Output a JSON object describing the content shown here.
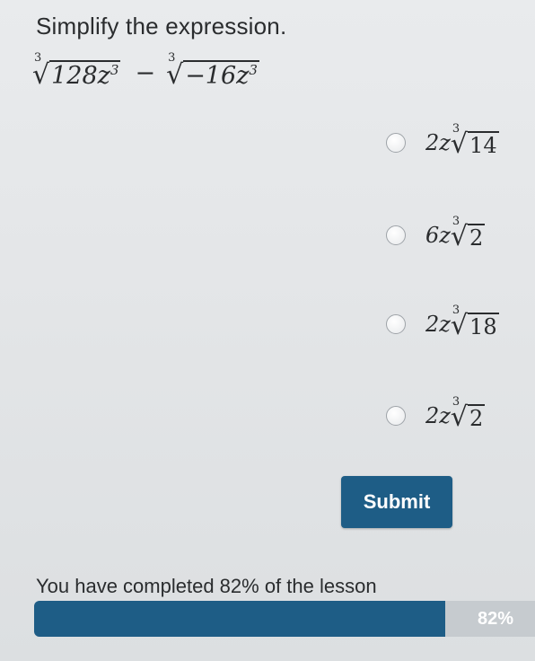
{
  "question": {
    "prompt": "Simplify the expression.",
    "expression": {
      "term1": {
        "index": "3",
        "radicand": "128z",
        "exponent": "3"
      },
      "operator": "−",
      "term2": {
        "index": "3",
        "radicand": "−16z",
        "exponent": "3"
      }
    }
  },
  "options": [
    {
      "coef": "2z",
      "index": "3",
      "radicand": "14"
    },
    {
      "coef": "6z",
      "index": "3",
      "radicand": "2"
    },
    {
      "coef": "2z",
      "index": "3",
      "radicand": "18"
    },
    {
      "coef": "2z",
      "index": "3",
      "radicand": "2"
    }
  ],
  "submit_label": "Submit",
  "progress": {
    "text": "You have completed 82% of the lesson",
    "label": "82%",
    "value": 0.82
  },
  "colors": {
    "accent": "#1e5d86",
    "track": "#c6cbcf",
    "background": "#e6e8ea"
  }
}
